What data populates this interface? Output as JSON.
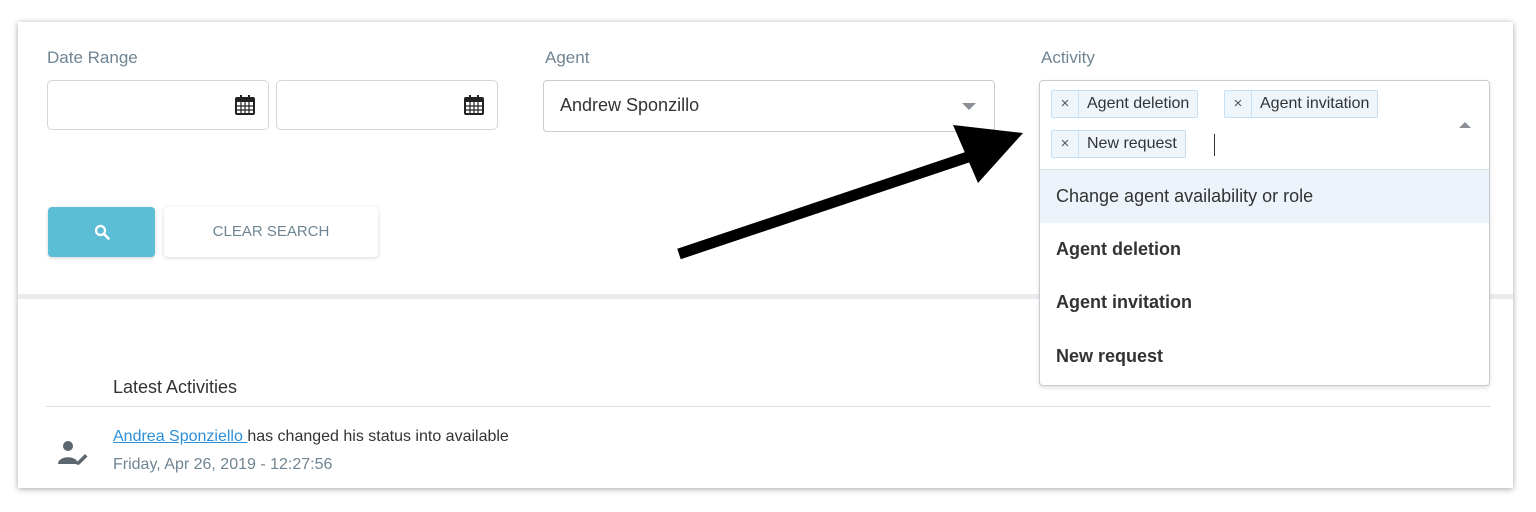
{
  "filters": {
    "date_range_label": "Date Range",
    "date_from_value": "",
    "date_to_value": "",
    "agent_label": "Agent",
    "agent_value": "Andrew Sponzillo",
    "activity_label": "Activity",
    "activity_tags": [
      "Agent deletion",
      "Agent invitation",
      "New request"
    ],
    "activity_options": [
      "Change agent availability or role",
      "Agent deletion",
      "Agent invitation",
      "New request"
    ]
  },
  "buttons": {
    "clear_label": "CLEAR SEARCH"
  },
  "activities": {
    "title": "Latest Activities",
    "items": [
      {
        "user": "Andrea Sponziello ",
        "text": "has changed his status into available",
        "time": "Friday, Apr 26, 2019 - 12:27:56"
      }
    ]
  },
  "colors": {
    "accent": "#5bbdd6",
    "link": "#2d8fd8",
    "label": "#6f8594",
    "tag_bg": "#eef6fc",
    "highlight_bg": "#edf3fa",
    "annotation_arrow": "#000000"
  },
  "icons": {
    "calendar": "calendar-icon",
    "search": "search-icon",
    "user_edit": "user-edit-icon",
    "remove": "remove-tag-icon"
  }
}
